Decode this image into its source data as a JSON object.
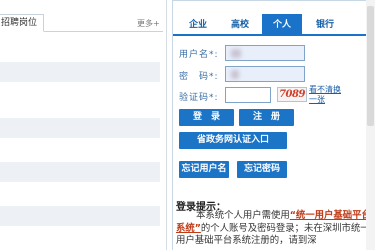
{
  "left_panel": {
    "tab_label": "招聘岗位",
    "more_label": "更多+"
  },
  "login_panel": {
    "tabs": [
      {
        "label": "企业",
        "active": false
      },
      {
        "label": "高校",
        "active": false
      },
      {
        "label": "个人",
        "active": true
      },
      {
        "label": "银行",
        "active": false
      }
    ],
    "username_label": "用户名*:",
    "password_label": "密　码*:",
    "captcha_label": "验证码*:",
    "captcha_text": "7089",
    "refresh_text": "看不清换一张",
    "login_button": "登　录",
    "register_button": "注　册",
    "gov_auth_button": "省政务网认证入口",
    "forgot_username_button": "忘记用户名",
    "forgot_password_button": "忘记密码",
    "tips_title": "登录提示：",
    "tips_intro": "本系统个人用户需使用",
    "tips_link": "“统一用户基础平台系统”",
    "tips_rest": "的个人账号及密码登录；未在深圳市统一用户基础平台系统注册的，请到深"
  },
  "colors": {
    "accent": "#1a73c9",
    "input_bg": "#e8effb",
    "link_red": "#c03b17"
  }
}
